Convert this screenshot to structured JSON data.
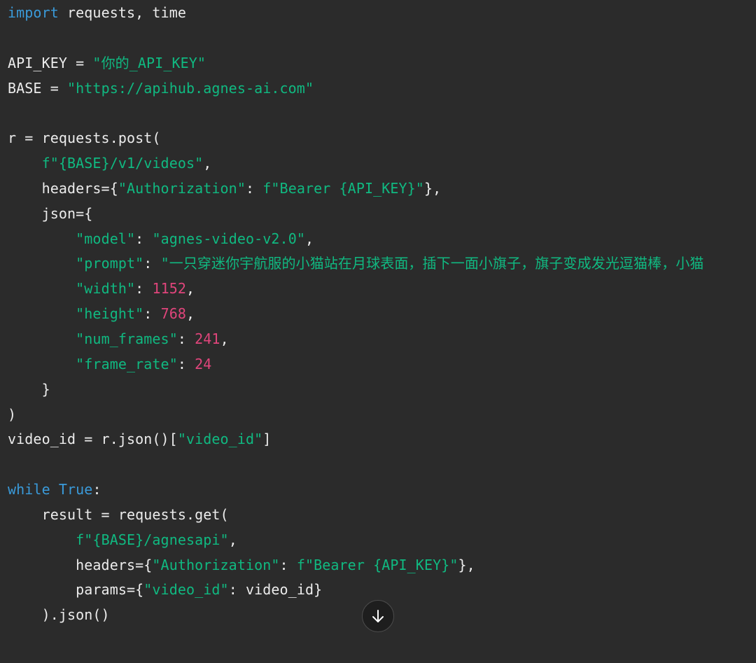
{
  "colors": {
    "background": "#2b2b2b",
    "plain": "#ececec",
    "keyword": "#3a9ad9",
    "string": "#10b981",
    "number": "#e0457b",
    "button_background": "#1e1e1e"
  },
  "scroll_button": {
    "icon": "arrow-down-icon"
  },
  "code": [
    [
      {
        "t": "keyword",
        "v": "import"
      },
      {
        "t": "plain",
        "v": " requests, time"
      }
    ],
    [],
    [
      {
        "t": "plain",
        "v": "API_KEY = "
      },
      {
        "t": "string",
        "v": "\"你的_API_KEY\""
      }
    ],
    [
      {
        "t": "plain",
        "v": "BASE = "
      },
      {
        "t": "string",
        "v": "\"https://apihub.agnes-ai.com\""
      }
    ],
    [],
    [
      {
        "t": "plain",
        "v": "r = requests.post("
      }
    ],
    [
      {
        "t": "plain",
        "v": "    "
      },
      {
        "t": "string",
        "v": "f\"{BASE}/v1/videos\""
      },
      {
        "t": "plain",
        "v": ","
      }
    ],
    [
      {
        "t": "plain",
        "v": "    headers={"
      },
      {
        "t": "string",
        "v": "\"Authorization\""
      },
      {
        "t": "plain",
        "v": ": "
      },
      {
        "t": "string",
        "v": "f\"Bearer {API_KEY}\""
      },
      {
        "t": "plain",
        "v": "},"
      }
    ],
    [
      {
        "t": "plain",
        "v": "    json={"
      }
    ],
    [
      {
        "t": "plain",
        "v": "        "
      },
      {
        "t": "string",
        "v": "\"model\""
      },
      {
        "t": "plain",
        "v": ": "
      },
      {
        "t": "string",
        "v": "\"agnes-video-v2.0\""
      },
      {
        "t": "plain",
        "v": ","
      }
    ],
    [
      {
        "t": "plain",
        "v": "        "
      },
      {
        "t": "string",
        "v": "\"prompt\""
      },
      {
        "t": "plain",
        "v": ": "
      },
      {
        "t": "string",
        "v": "\"一只穿迷你宇航服的小猫站在月球表面，插下一面小旗子，旗子变成发光逗猫棒，小猫"
      }
    ],
    [
      {
        "t": "plain",
        "v": "        "
      },
      {
        "t": "string",
        "v": "\"width\""
      },
      {
        "t": "plain",
        "v": ": "
      },
      {
        "t": "number",
        "v": "1152"
      },
      {
        "t": "plain",
        "v": ","
      }
    ],
    [
      {
        "t": "plain",
        "v": "        "
      },
      {
        "t": "string",
        "v": "\"height\""
      },
      {
        "t": "plain",
        "v": ": "
      },
      {
        "t": "number",
        "v": "768"
      },
      {
        "t": "plain",
        "v": ","
      }
    ],
    [
      {
        "t": "plain",
        "v": "        "
      },
      {
        "t": "string",
        "v": "\"num_frames\""
      },
      {
        "t": "plain",
        "v": ": "
      },
      {
        "t": "number",
        "v": "241"
      },
      {
        "t": "plain",
        "v": ","
      }
    ],
    [
      {
        "t": "plain",
        "v": "        "
      },
      {
        "t": "string",
        "v": "\"frame_rate\""
      },
      {
        "t": "plain",
        "v": ": "
      },
      {
        "t": "number",
        "v": "24"
      }
    ],
    [
      {
        "t": "plain",
        "v": "    }"
      }
    ],
    [
      {
        "t": "plain",
        "v": ")"
      }
    ],
    [
      {
        "t": "plain",
        "v": "video_id = r.json()["
      },
      {
        "t": "string",
        "v": "\"video_id\""
      },
      {
        "t": "plain",
        "v": "]"
      }
    ],
    [],
    [
      {
        "t": "keyword",
        "v": "while"
      },
      {
        "t": "plain",
        "v": " "
      },
      {
        "t": "keyword",
        "v": "True"
      },
      {
        "t": "plain",
        "v": ":"
      }
    ],
    [
      {
        "t": "plain",
        "v": "    result = requests.get("
      }
    ],
    [
      {
        "t": "plain",
        "v": "        "
      },
      {
        "t": "string",
        "v": "f\"{BASE}/agnesapi\""
      },
      {
        "t": "plain",
        "v": ","
      }
    ],
    [
      {
        "t": "plain",
        "v": "        headers={"
      },
      {
        "t": "string",
        "v": "\"Authorization\""
      },
      {
        "t": "plain",
        "v": ": "
      },
      {
        "t": "string",
        "v": "f\"Bearer {API_KEY}\""
      },
      {
        "t": "plain",
        "v": "},"
      }
    ],
    [
      {
        "t": "plain",
        "v": "        params={"
      },
      {
        "t": "string",
        "v": "\"video_id\""
      },
      {
        "t": "plain",
        "v": ": video_id}"
      }
    ],
    [
      {
        "t": "plain",
        "v": "    ).json()"
      }
    ]
  ]
}
